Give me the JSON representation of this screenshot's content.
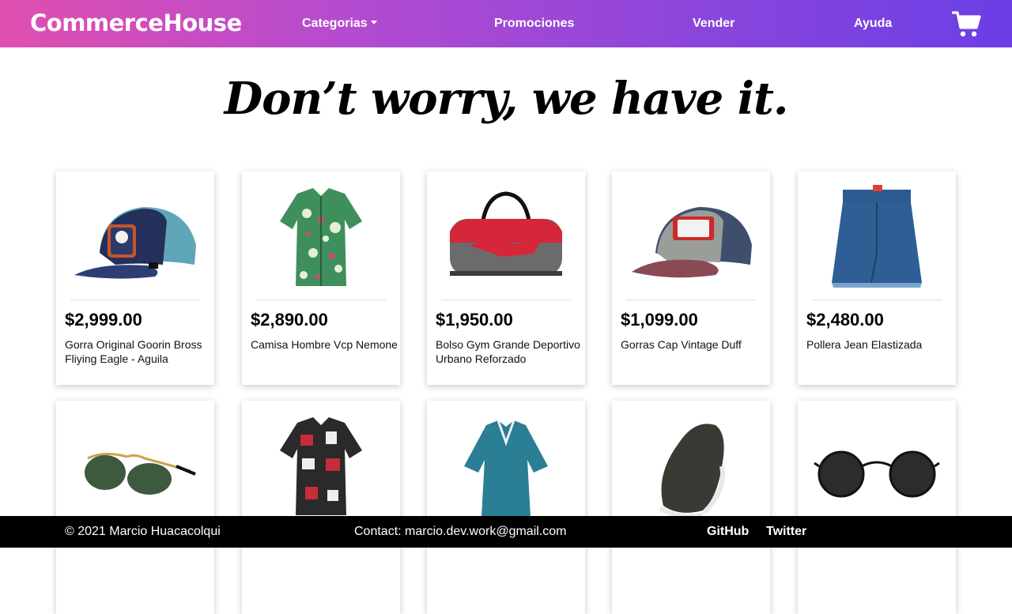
{
  "header": {
    "brand": "CommerceHouse",
    "nav": {
      "categories": "Categorias",
      "promotions": "Promociones",
      "sell": "Vender",
      "help": "Ayuda"
    },
    "cart_icon": "shopping-cart-icon"
  },
  "hero": {
    "title": "Don’t worry, we have it."
  },
  "products": [
    {
      "price": "$2,999.00",
      "name": "Gorra Original Goorin Bross Fliying Eagle - Aguila",
      "icon": "cap-icon"
    },
    {
      "price": "$2,890.00",
      "name": "Camisa Hombre Vcp Nemone",
      "icon": "shirt-icon"
    },
    {
      "price": "$1,950.00",
      "name": "Bolso Gym Grande Deportivo Urbano Reforzado",
      "icon": "bag-icon"
    },
    {
      "price": "$1,099.00",
      "name": "Gorras Cap Vintage Duff",
      "icon": "cap-icon"
    },
    {
      "price": "$2,480.00",
      "name": "Pollera Jean Elastizada",
      "icon": "skirt-icon"
    },
    {
      "price": "",
      "name": "",
      "icon": "sunglasses-icon"
    },
    {
      "price": "",
      "name": "",
      "icon": "shirt-icon"
    },
    {
      "price": "",
      "name": "",
      "icon": "tunic-icon"
    },
    {
      "price": "",
      "name": "",
      "icon": "sneaker-icon"
    },
    {
      "price": "",
      "name": "",
      "icon": "sunglasses-icon"
    }
  ],
  "footer": {
    "copyright": "© 2021 Marcio Huacacolqui",
    "contact": "Contact: marcio.dev.work@gmail.com",
    "github": "GitHub",
    "twitter": "Twitter"
  },
  "colors": {
    "header_gradient_start": "#e04fb0",
    "header_gradient_end": "#6b3ee6",
    "footer_bg": "#000000"
  }
}
